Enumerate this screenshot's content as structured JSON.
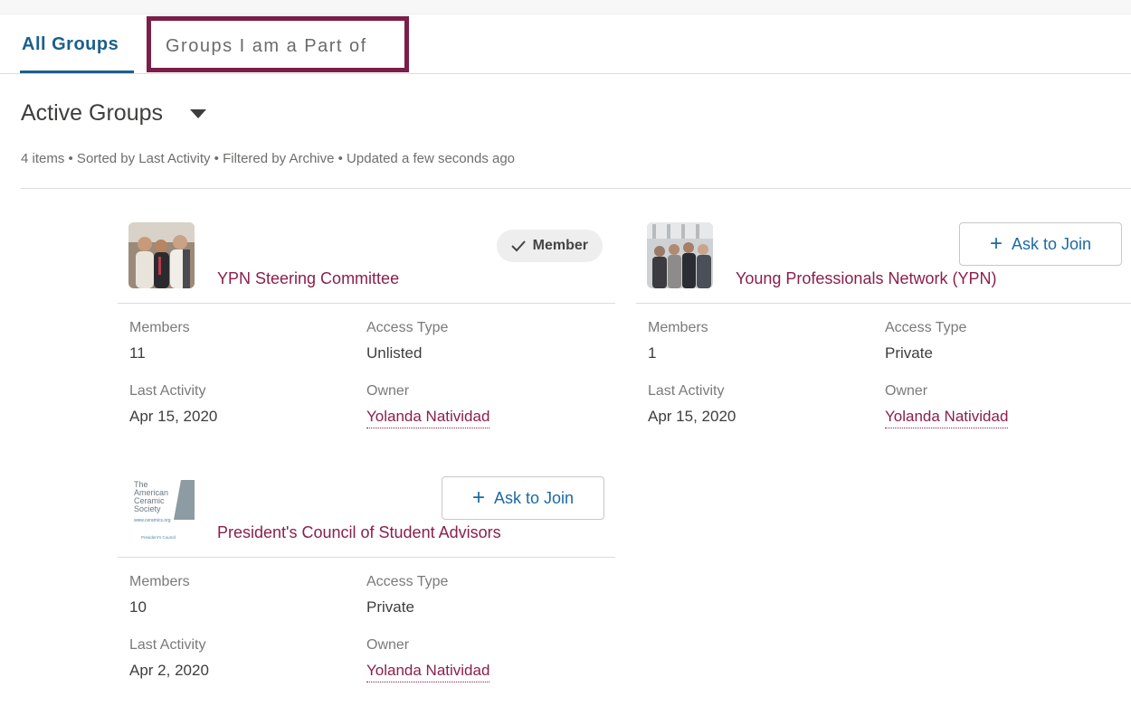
{
  "tabs": {
    "all_groups": "All Groups",
    "my_groups": "Groups I am a Part of"
  },
  "list": {
    "title": "Active Groups",
    "meta": "4 items • Sorted by Last Activity • Filtered by Archive • Updated a few seconds ago"
  },
  "field_labels": {
    "members": "Members",
    "access_type": "Access Type",
    "last_activity": "Last Activity",
    "owner": "Owner"
  },
  "groups": [
    {
      "name": "YPN Steering Committee",
      "status_label": "Member",
      "members": "11",
      "access_type": "Unlisted",
      "last_activity": "Apr 15, 2020",
      "owner": "Yolanda Natividad"
    },
    {
      "name": "Young Professionals Network (YPN)",
      "action_label": "Ask to Join",
      "members": "1",
      "access_type": "Private",
      "last_activity": "Apr 15, 2020",
      "owner": "Yolanda Natividad"
    },
    {
      "name": "President's Council of Student Advisors",
      "action_label": "Ask to Join",
      "members": "10",
      "access_type": "Private",
      "last_activity": "Apr 2, 2020",
      "owner": "Yolanda Natividad"
    }
  ],
  "logo_text": {
    "line1": "The",
    "line2": "American",
    "line3": "Ceramic",
    "line4": "Society",
    "url": "www.ceramics.org",
    "caption": "President's Council"
  },
  "colors": {
    "tab_active": "#1b5f8c",
    "highlight_border": "#7b1e48",
    "link": "#8a1f4e",
    "button_text": "#1b6aa5"
  }
}
